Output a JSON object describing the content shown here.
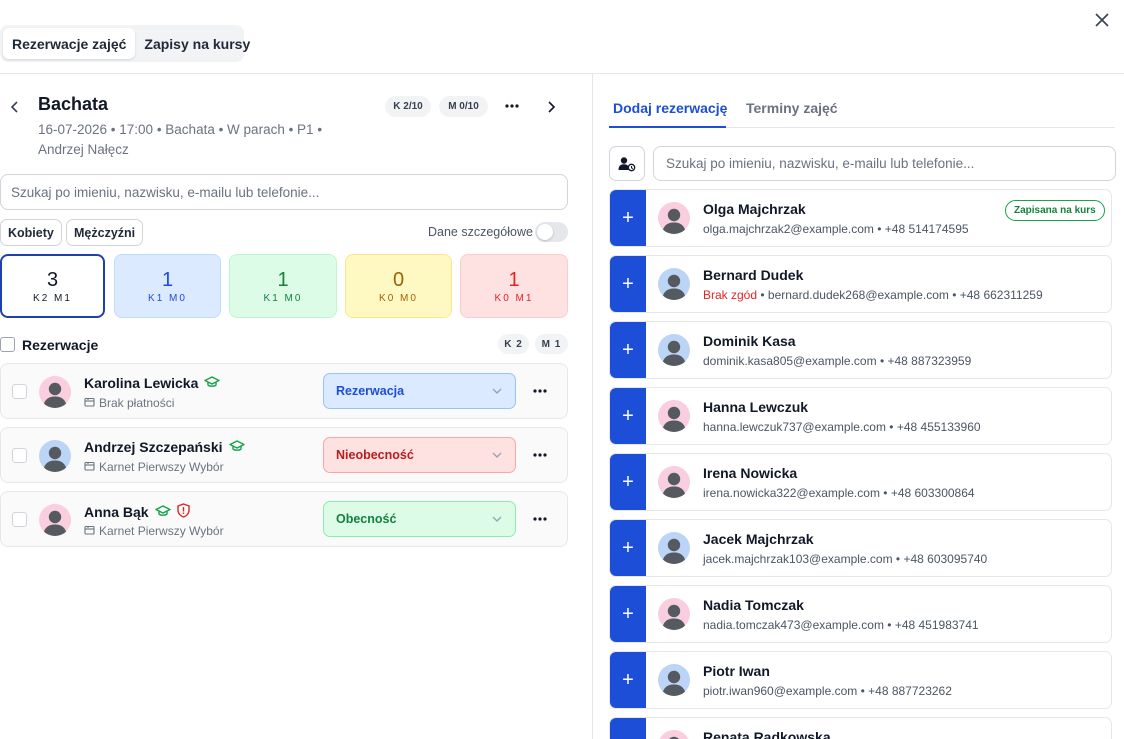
{
  "top_tabs": [
    {
      "label": "Rezerwacje zajęć",
      "active": true
    },
    {
      "label": "Zapisy na kursy",
      "active": false
    }
  ],
  "class_info": {
    "title": "Bachata",
    "meta_line1": "16-07-2026 • 17:00 • Bachata • W parach • P1 •",
    "meta_line2": "Andrzej Nałęcz",
    "women_pill": "K 2/10",
    "men_pill": "M 0/10"
  },
  "left_search": {
    "placeholder": "Szukaj po imieniu, nazwisku, e-mailu lub telefonie..."
  },
  "filters": {
    "women": "Kobiety",
    "men": "Mężczyźni",
    "details_toggle_label": "Dane szczegółowe"
  },
  "stats": [
    {
      "value": "3",
      "sub": "K2 M1",
      "color": "#111827",
      "bg": "#ffffff",
      "border": "#1e40af"
    },
    {
      "value": "1",
      "sub": "K1 M0",
      "color": "#1d4ed8",
      "bg": "#dbeafe",
      "border": "#bfdbfe"
    },
    {
      "value": "1",
      "sub": "K1 M0",
      "color": "#15803d",
      "bg": "#dcfce7",
      "border": "#bbf7d0"
    },
    {
      "value": "0",
      "sub": "K0 M0",
      "color": "#a16207",
      "bg": "#fef9c3",
      "border": "#fde68a"
    },
    {
      "value": "1",
      "sub": "K0 M1",
      "color": "#dc2626",
      "bg": "#fee2e2",
      "border": "#fecaca"
    }
  ],
  "reservations_header": {
    "label": "Rezerwacje",
    "women_count": "K 2",
    "men_count": "M 1"
  },
  "reservations": [
    {
      "name": "Karolina Lewicka",
      "payment": "Brak płatności",
      "status": "Rezerwacja",
      "status_color": "#1d4ed8",
      "status_bg": "#dbeafe",
      "status_border": "#93c5fd",
      "gender": "f",
      "warning": false
    },
    {
      "name": "Andrzej Szczepański",
      "payment": "Karnet Pierwszy Wybór",
      "status": "Nieobecność",
      "status_color": "#b91c1c",
      "status_bg": "#fee2e2",
      "status_border": "#fca5a5",
      "gender": "m",
      "warning": false
    },
    {
      "name": "Anna Bąk",
      "payment": "Karnet Pierwszy Wybór",
      "status": "Obecność",
      "status_color": "#15803d",
      "status_bg": "#dcfce7",
      "status_border": "#86efac",
      "gender": "f",
      "warning": true
    }
  ],
  "right_tabs": [
    {
      "label": "Dodaj rezerwację",
      "active": true
    },
    {
      "label": "Terminy zajęć",
      "active": false
    }
  ],
  "right_search": {
    "placeholder": "Szukaj po imieniu, nazwisku, e-mailu lub telefonie..."
  },
  "people": [
    {
      "name": "Olga Majchrzak",
      "email": "olga.majchrzak2@example.com",
      "phone": "+48 514174595",
      "gender": "f",
      "badge": "Zapisana na kurs",
      "warning": ""
    },
    {
      "name": "Bernard Dudek",
      "email": "bernard.dudek268@example.com",
      "phone": "+48 662311259",
      "gender": "m",
      "badge": "",
      "warning": "Brak zgód"
    },
    {
      "name": "Dominik Kasa",
      "email": "dominik.kasa805@example.com",
      "phone": "+48 887323959",
      "gender": "m",
      "badge": "",
      "warning": ""
    },
    {
      "name": "Hanna Lewczuk",
      "email": "hanna.lewczuk737@example.com",
      "phone": "+48 455133960",
      "gender": "f",
      "badge": "",
      "warning": ""
    },
    {
      "name": "Irena Nowicka",
      "email": "irena.nowicka322@example.com",
      "phone": "+48 603300864",
      "gender": "f",
      "badge": "",
      "warning": ""
    },
    {
      "name": "Jacek Majchrzak",
      "email": "jacek.majchrzak103@example.com",
      "phone": "+48 603095740",
      "gender": "m",
      "badge": "",
      "warning": ""
    },
    {
      "name": "Nadia Tomczak",
      "email": "nadia.tomczak473@example.com",
      "phone": "+48 451983741",
      "gender": "f",
      "badge": "",
      "warning": ""
    },
    {
      "name": "Piotr Iwan",
      "email": "piotr.iwan960@example.com",
      "phone": "+48 887723262",
      "gender": "m",
      "badge": "",
      "warning": ""
    },
    {
      "name": "Renata Radkowska",
      "email": "",
      "phone": "",
      "gender": "f",
      "badge": "",
      "warning": ""
    }
  ]
}
